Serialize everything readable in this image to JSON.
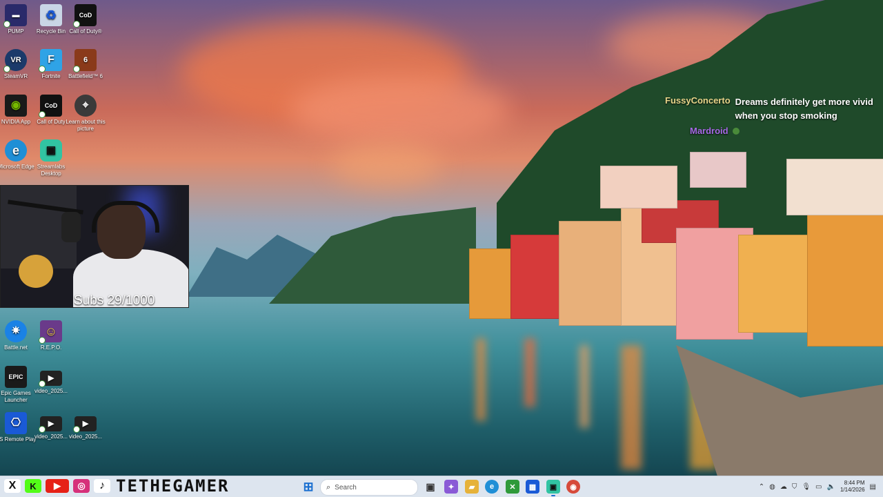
{
  "desktop_icons": [
    {
      "label": "PUMP",
      "icon": "pump-icon",
      "color": "#2a2a6a",
      "glyph": "▬"
    },
    {
      "label": "Recycle Bin",
      "icon": "recycle-bin-icon",
      "color": "#c9d6e6",
      "glyph": "♻"
    },
    {
      "label": "Call of Duty®",
      "icon": "call-of-duty-icon",
      "color": "#111111",
      "glyph": "CoD"
    },
    {
      "label": "SteamVR",
      "icon": "steamvr-icon",
      "color": "#1b3a6a",
      "glyph": "VR"
    },
    {
      "label": "Fortnite",
      "icon": "fortnite-icon",
      "color": "#2fa3e6",
      "glyph": "F"
    },
    {
      "label": "Battlefield™ 6",
      "icon": "battlefield-icon",
      "color": "#8a3a1a",
      "glyph": "6"
    },
    {
      "label": "NVIDIA App",
      "icon": "nvidia-icon",
      "color": "#1a1a1a",
      "glyph": "◉"
    },
    {
      "label": "Call of Duty",
      "icon": "call-of-duty-icon",
      "color": "#111111",
      "glyph": "CoD"
    },
    {
      "label": "Learn about this picture",
      "icon": "camera-icon",
      "color": "#3a3a3a",
      "glyph": "⌖"
    },
    {
      "label": "Microsoft Edge",
      "icon": "edge-icon",
      "color": "#1f8fd6",
      "glyph": "e"
    },
    {
      "label": "Streamlabs Desktop",
      "icon": "streamlabs-icon",
      "color": "#31c3a2",
      "glyph": "▣"
    },
    {
      "label": "Battle.net",
      "icon": "battlenet-icon",
      "color": "#1a82e6",
      "glyph": "✷"
    },
    {
      "label": "R.E.P.O.",
      "icon": "repo-icon",
      "color": "#6a3a8a",
      "glyph": "☺"
    },
    {
      "label": "Epic Games Launcher",
      "icon": "epic-games-icon",
      "color": "#1a1a1a",
      "glyph": "EPIC"
    },
    {
      "label": "video_2025...",
      "icon": "video-file-icon",
      "color": "#222222",
      "glyph": "▶"
    },
    {
      "label": "PS Remote Play",
      "icon": "ps-remote-play-icon",
      "color": "#1a5ad6",
      "glyph": "⎔"
    },
    {
      "label": "video_2025...",
      "icon": "video-file-icon",
      "color": "#222222",
      "glyph": "▶"
    },
    {
      "label": "video_2025...",
      "icon": "video-file-icon",
      "color": "#222222",
      "glyph": "▶"
    }
  ],
  "webcam": {
    "subs_text": "Subs 29/1000"
  },
  "chat": {
    "messages": [
      {
        "user": "FussyConcerto",
        "text": "Dreams definitely get more vivid when you stop smoking"
      },
      {
        "user": "Mardroid",
        "text": ""
      }
    ]
  },
  "taskbar": {
    "brand_name": "TETHEGAMER",
    "socials": [
      {
        "icon": "x-icon",
        "glyph": "X",
        "color": "#111111"
      },
      {
        "icon": "kick-icon",
        "glyph": "K",
        "color": "#53fc18"
      },
      {
        "icon": "youtube-icon",
        "glyph": "▶",
        "color": "#e62117"
      },
      {
        "icon": "instagram-icon",
        "glyph": "◎",
        "color": "#d6307a"
      },
      {
        "icon": "tiktok-icon",
        "glyph": "♪",
        "color": "#111111"
      }
    ],
    "search_placeholder": "Search",
    "apps": [
      {
        "icon": "start-icon",
        "glyph": "⊞",
        "color": "#1a6fd0"
      },
      {
        "icon": "task-view-icon",
        "glyph": "▣",
        "color": "#333333"
      },
      {
        "icon": "copilot-icon",
        "glyph": "✦",
        "color": "#8a5ad6"
      },
      {
        "icon": "file-explorer-icon",
        "glyph": "▰",
        "color": "#e6b23a"
      },
      {
        "icon": "edge-icon",
        "glyph": "e",
        "color": "#1f8fd6"
      },
      {
        "icon": "xbox-icon",
        "glyph": "✕",
        "color": "#2f9a3a"
      },
      {
        "icon": "store-icon",
        "glyph": "▦",
        "color": "#1a5ad6"
      },
      {
        "icon": "streamlabs-icon",
        "glyph": "▣",
        "color": "#31c3a2"
      },
      {
        "icon": "chrome-icon",
        "glyph": "◉",
        "color": "#d64a3a"
      }
    ],
    "clock_time": "8:44 PM",
    "clock_date": "1/14/2026"
  }
}
